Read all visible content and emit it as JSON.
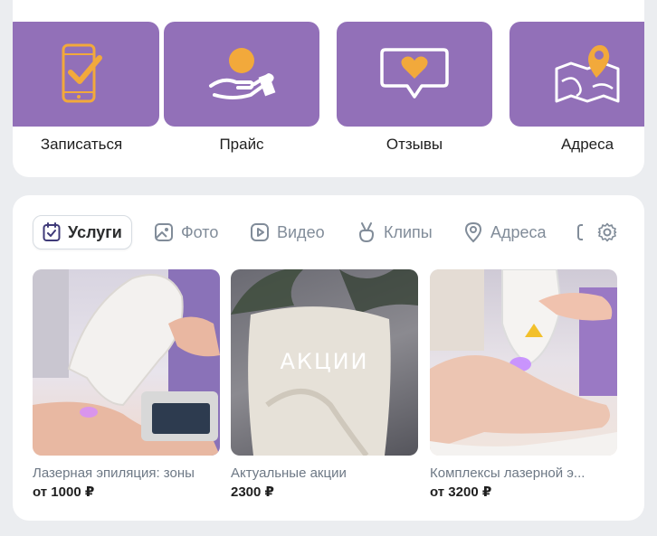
{
  "actions": [
    {
      "label": "Записаться",
      "icon": "phone-check-icon"
    },
    {
      "label": "Прайс",
      "icon": "hand-coin-icon"
    },
    {
      "label": "Отзывы",
      "icon": "heart-message-icon"
    },
    {
      "label": "Адреса",
      "icon": "map-pin-icon"
    }
  ],
  "tabs": [
    {
      "label": "Услуги",
      "icon": "calendar-check-icon",
      "active": true
    },
    {
      "label": "Фото",
      "icon": "image-icon",
      "active": false
    },
    {
      "label": "Видео",
      "icon": "play-icon",
      "active": false
    },
    {
      "label": "Клипы",
      "icon": "clips-icon",
      "active": false
    },
    {
      "label": "Адреса",
      "icon": "location-pin-icon",
      "active": false
    }
  ],
  "products": [
    {
      "title": "Лазерная эпиляция: зоны",
      "price": "от 1000 ₽"
    },
    {
      "title": "Актуальные акции",
      "price": "2300 ₽",
      "overlay": "АКЦИИ"
    },
    {
      "title": "Комплексы лазерной э...",
      "price": "от 3200 ₽"
    }
  ],
  "colors": {
    "tile": "#9270b8",
    "accent_orange": "#f2a93b",
    "tab_active_icon": "#3f3a78",
    "muted": "#818c99"
  }
}
